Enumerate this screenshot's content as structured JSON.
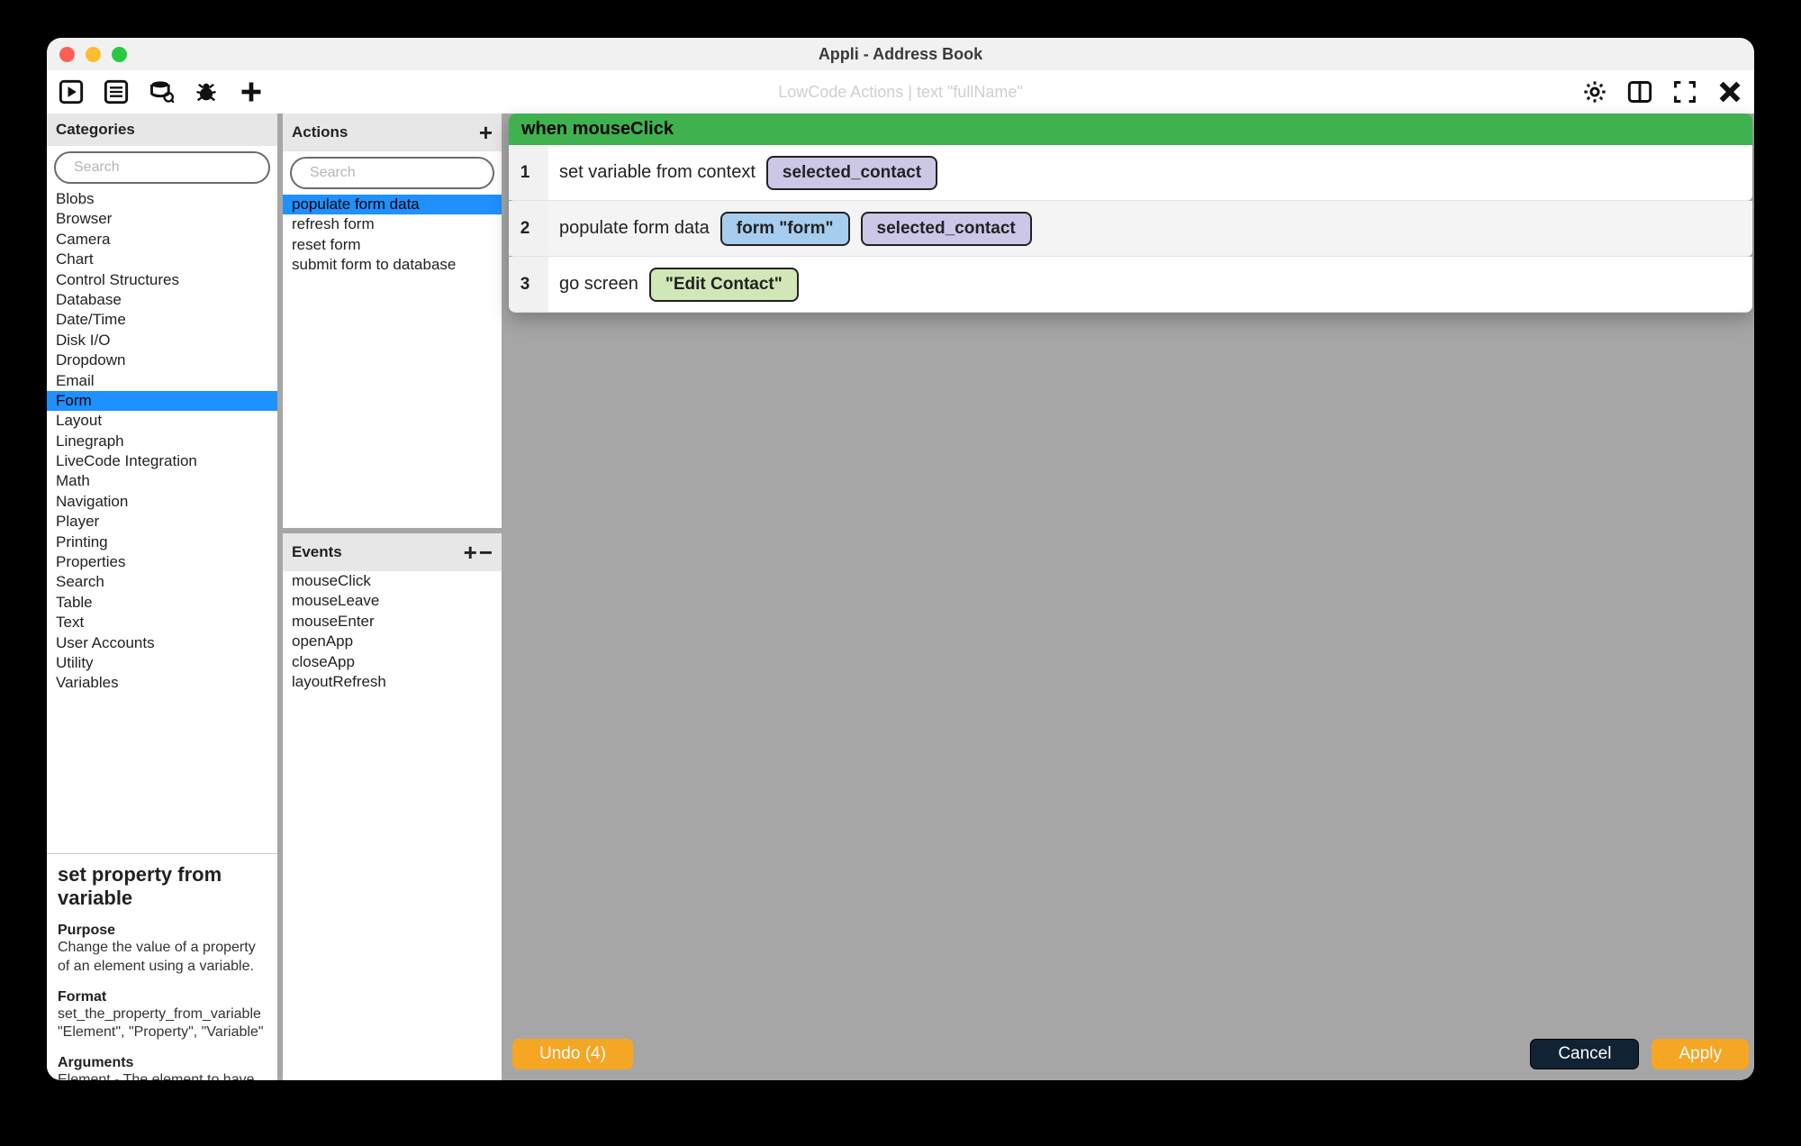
{
  "window": {
    "title": "Appli - Address Book"
  },
  "toolbar": {
    "subtitle": "LowCode Actions | text \"fullName\""
  },
  "categories": {
    "title": "Categories",
    "search_placeholder": "Search",
    "items": [
      "Blobs",
      "Browser",
      "Camera",
      "Chart",
      "Control Structures",
      "Database",
      "Date/Time",
      "Disk I/O",
      "Dropdown",
      "Email",
      "Form",
      "Layout",
      "Linegraph",
      "LiveCode Integration",
      "Math",
      "Navigation",
      "Player",
      "Printing",
      "Properties",
      "Search",
      "Table",
      "Text",
      "User Accounts",
      "Utility",
      "Variables"
    ],
    "selected": "Form"
  },
  "actions": {
    "title": "Actions",
    "search_placeholder": "Search",
    "items": [
      "populate form data",
      "refresh form",
      "reset form",
      "submit form to database"
    ],
    "selected": "populate form data"
  },
  "events": {
    "title": "Events",
    "items": [
      "mouseClick",
      "mouseLeave",
      "mouseEnter",
      "openApp",
      "closeApp",
      "layoutRefresh"
    ]
  },
  "flow": {
    "header": "when mouseClick",
    "steps": [
      {
        "num": "1",
        "parts": [
          {
            "type": "text",
            "text": "set variable from context"
          },
          {
            "type": "pill",
            "style": "purple",
            "text": "selected_contact"
          }
        ]
      },
      {
        "num": "2",
        "parts": [
          {
            "type": "text",
            "text": "populate form data"
          },
          {
            "type": "pill",
            "style": "blue",
            "text": "form \"form\""
          },
          {
            "type": "pill",
            "style": "purple",
            "text": "selected_contact"
          }
        ]
      },
      {
        "num": "3",
        "parts": [
          {
            "type": "text",
            "text": "go screen"
          },
          {
            "type": "pill",
            "style": "green",
            "text": "\"Edit Contact\""
          }
        ]
      }
    ]
  },
  "help": {
    "title": "set property from variable",
    "sections": [
      {
        "title": "Purpose",
        "body": "Change the value of a property of an element using a variable."
      },
      {
        "title": "Format",
        "body": "set_the_property_from_variable \"Element\", \"Property\", \"Variable\""
      },
      {
        "title": "Arguments",
        "body": "Element - The element to have its property adjusted"
      }
    ]
  },
  "buttons": {
    "undo": "Undo (4)",
    "cancel": "Cancel",
    "apply": "Apply"
  }
}
